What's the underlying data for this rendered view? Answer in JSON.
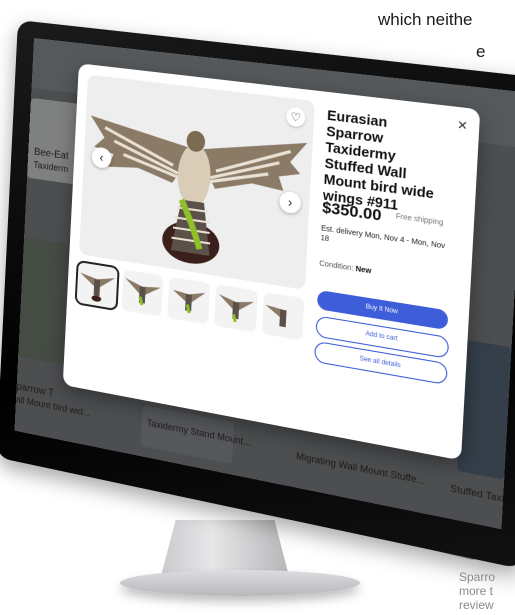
{
  "page": {
    "top_text_line_1": "which neithe",
    "top_text_line_2": "e",
    "caption_lines": [
      "Sparro",
      "more t",
      "review"
    ]
  },
  "background_listings": [
    {
      "label": "Bee-Eat",
      "sub": "Taxiderm"
    },
    {
      "label": "parrow T",
      "sub": "all Mount bird wid..."
    },
    {
      "label": "Taxidermy Stand Mount...",
      "sub": ""
    },
    {
      "label": "Migrating Wall Mount Stuffe...",
      "sub": ""
    },
    {
      "label": "Stuffed Taxidermy...",
      "sub": ""
    }
  ],
  "modal": {
    "title": "Eurasian Sparrow Taxidermy Stuffed Wall Mount bird wide wings #911",
    "price": "$350.00",
    "shipping": "Free shipping",
    "delivery": "Est. delivery Mon, Nov 4 - Mon, Nov 18",
    "condition_label": "Condition:",
    "condition_value": "New",
    "buy_label": "Buy It Now",
    "watch_label": "Add to cart",
    "details_label": "See all details",
    "close_icon": "close-icon",
    "heart_icon": "heart-icon",
    "prev_icon": "chevron-left-icon",
    "next_icon": "chevron-right-icon",
    "thumbnail_count": 5,
    "accent_color": "#3d5ed8"
  }
}
